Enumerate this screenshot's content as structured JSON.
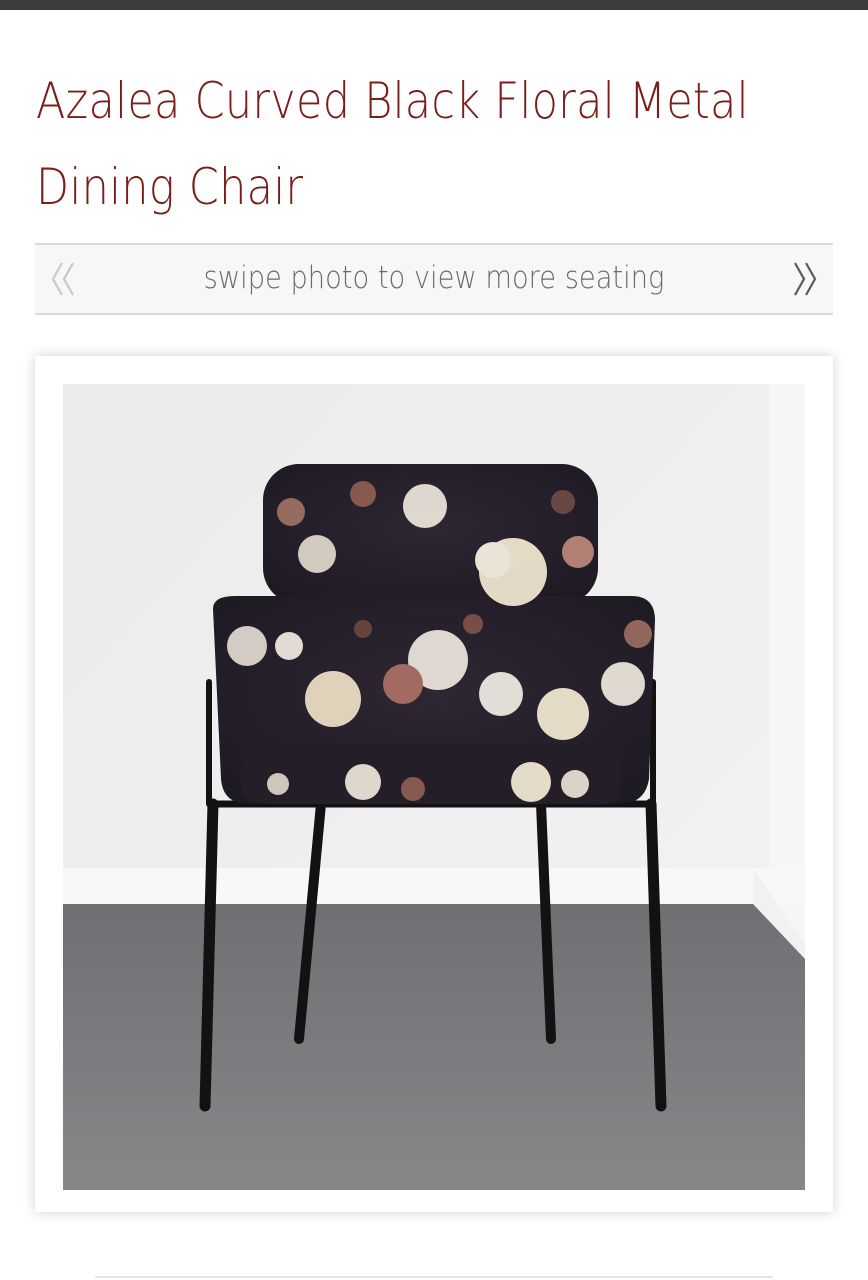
{
  "product": {
    "title_line1": "Azalea Curved Black Floral Metal",
    "title_line2": "Dining Chair"
  },
  "gallery": {
    "swipe_hint": "swipe photo to view more seating",
    "prev_icon": "double-chevron-left-icon",
    "next_icon": "double-chevron-right-icon"
  },
  "colors": {
    "title": "#7a1e1a",
    "top_bar": "#3a3d40",
    "upholstery": "#2a2430",
    "frame": "#151515"
  }
}
